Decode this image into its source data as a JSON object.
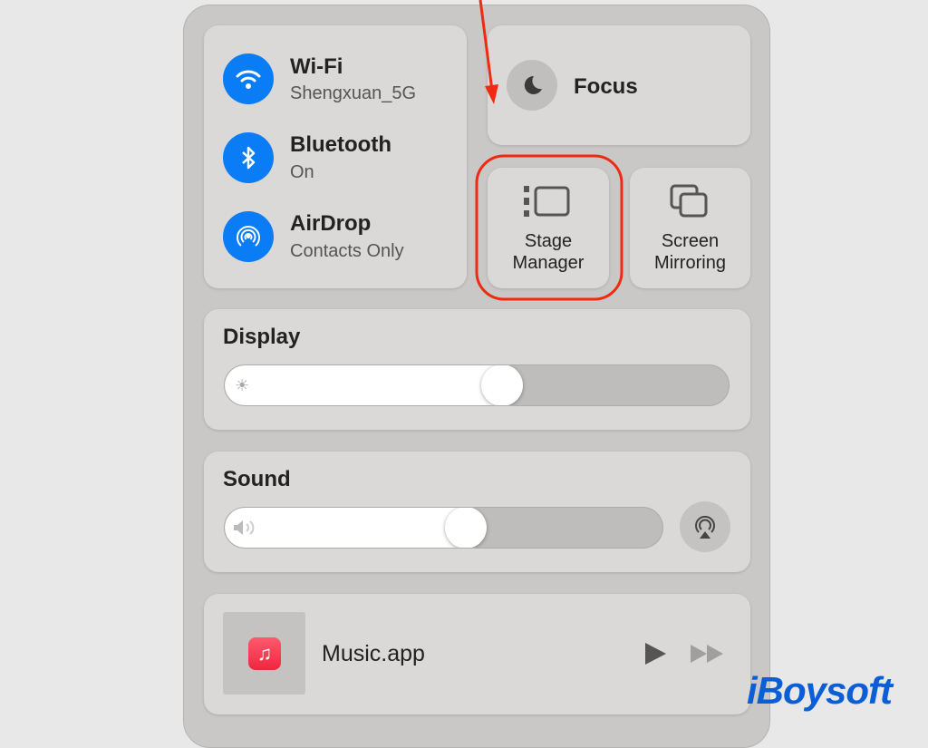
{
  "connectivity": [
    {
      "title": "Wi-Fi",
      "subtitle": "Shengxuan_5G",
      "icon": "wifi-icon"
    },
    {
      "title": "Bluetooth",
      "subtitle": "On",
      "icon": "bluetooth-icon"
    },
    {
      "title": "AirDrop",
      "subtitle": "Contacts Only",
      "icon": "airdrop-icon"
    }
  ],
  "focus": {
    "label": "Focus",
    "icon": "moon-icon"
  },
  "stage_manager": {
    "line1": "Stage",
    "line2": "Manager",
    "icon": "stage-manager-icon"
  },
  "screen_mirroring": {
    "line1": "Screen",
    "line2": "Mirroring",
    "icon": "screen-mirroring-icon"
  },
  "display": {
    "title": "Display",
    "brightness_percent": 55
  },
  "sound": {
    "title": "Sound",
    "volume_percent": 55
  },
  "now_playing": {
    "app": "Music.app"
  },
  "colors": {
    "accent": "#0a7cf6",
    "annotation": "#ee2a12",
    "watermark": "#0a5fd6"
  },
  "watermark": "iBoysoft"
}
